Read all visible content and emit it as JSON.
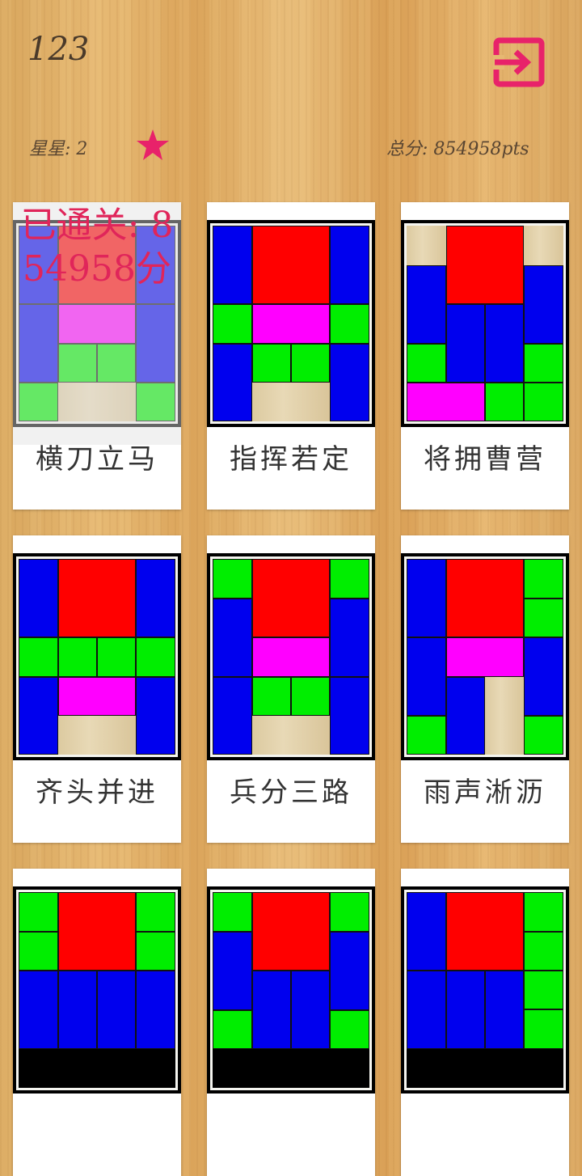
{
  "header": {
    "level_number": "123",
    "stars_text": "星星: 2",
    "score_text": "总分: 854958pts",
    "exit_icon": "exit-icon",
    "star_icon": "star-icon",
    "accent_color": "#e8226a"
  },
  "levels": [
    {
      "title": "横刀立马",
      "completed": true,
      "completed_text": "已通关: 854958分"
    },
    {
      "title": "指挥若定",
      "completed": false
    },
    {
      "title": "将拥曹营",
      "completed": false
    },
    {
      "title": "齐头并进",
      "completed": false
    },
    {
      "title": "兵分三路",
      "completed": false
    },
    {
      "title": "雨声淅沥",
      "completed": false
    },
    {
      "title": "",
      "completed": false
    },
    {
      "title": "",
      "completed": false
    },
    {
      "title": "",
      "completed": false
    }
  ],
  "colors": {
    "soldier_blue": "#0000ee",
    "caocao_red": "#ff0000",
    "pawn_green": "#00ee00",
    "guanyu_magenta": "#ff00ff"
  }
}
